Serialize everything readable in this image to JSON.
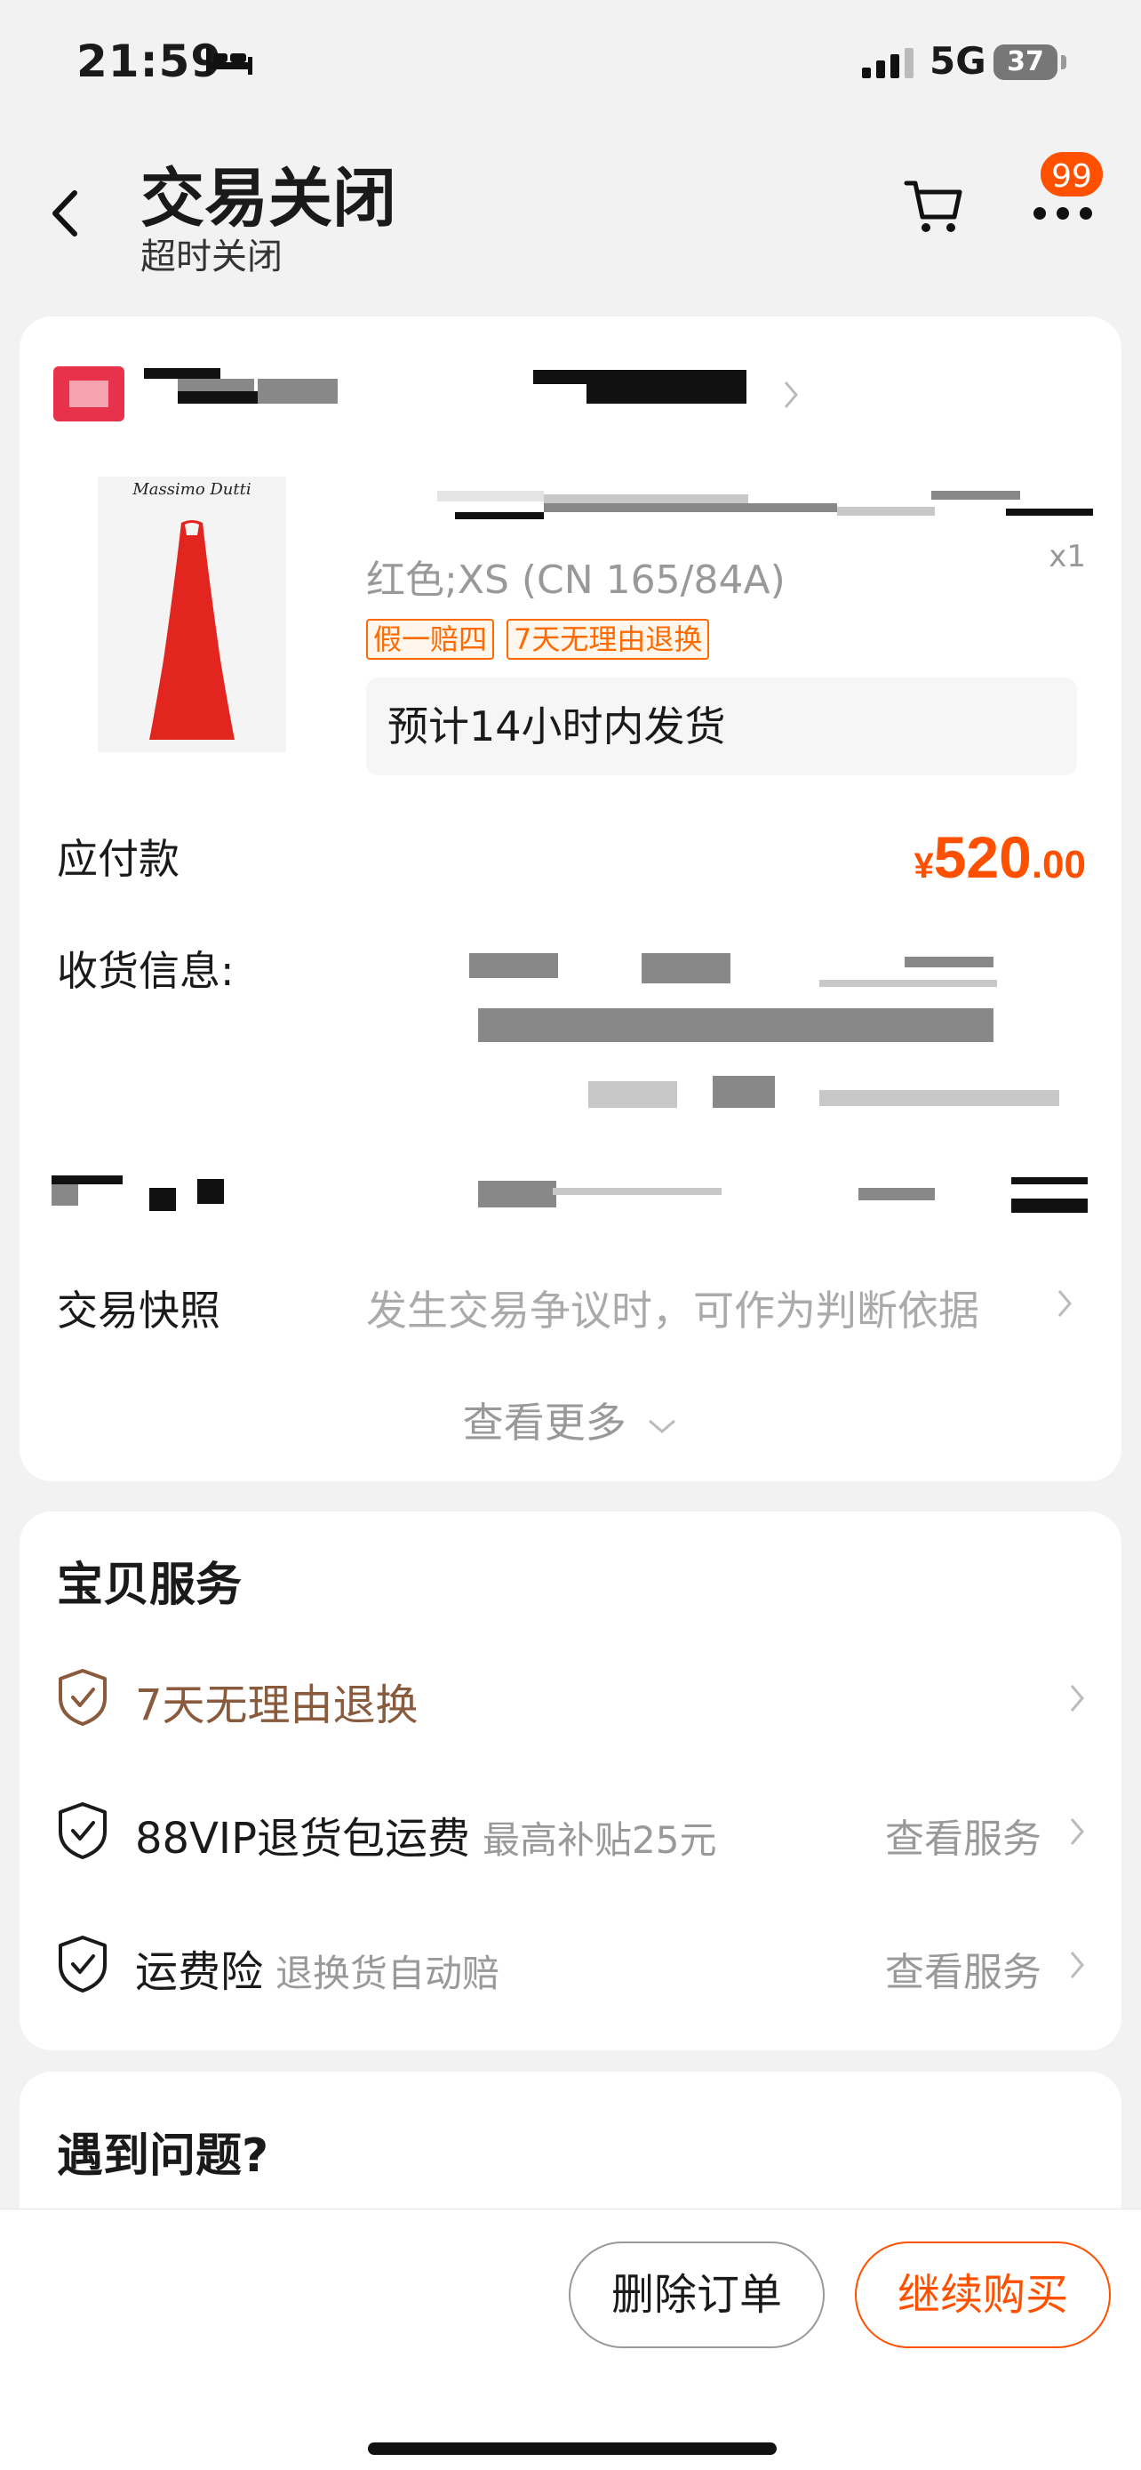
{
  "status_bar": {
    "time": "21:59",
    "network": "5G",
    "battery": "37"
  },
  "header": {
    "title": "交易关闭",
    "subtitle": "超时关闭",
    "badge_count": "99"
  },
  "order": {
    "product_brand": "Massimo Dutti",
    "variant": "红色;XS (CN 165/84A)",
    "quantity": "x1",
    "tags": [
      "假一赔四",
      "7天无理由退换"
    ],
    "shipping_note": "预计14小时内发货",
    "payable_label": "应付款",
    "price": {
      "currency": "¥",
      "integer": "520",
      "decimal": ".00"
    },
    "address_label": "收货信息:",
    "snapshot_label": "交易快照",
    "snapshot_hint": "发生交易争议时，可作为判断依据",
    "see_more": "查看更多"
  },
  "services": {
    "title": "宝贝服务",
    "items": [
      {
        "name": "7天无理由退换",
        "note": "",
        "link": "",
        "color": "#8a5a3c"
      },
      {
        "name": "88VIP退货包运费",
        "note": "最高补贴25元",
        "link": "查看服务",
        "color": "#1a1a1a"
      },
      {
        "name": "运费险",
        "note": "退换货自动赔",
        "link": "查看服务",
        "color": "#1a1a1a"
      }
    ]
  },
  "problem": {
    "title": "遇到问题?"
  },
  "actions": {
    "delete_label": "删除订单",
    "buy_label": "继续购买"
  },
  "colors": {
    "accent": "#ff5000",
    "background": "#f2f2f2"
  }
}
